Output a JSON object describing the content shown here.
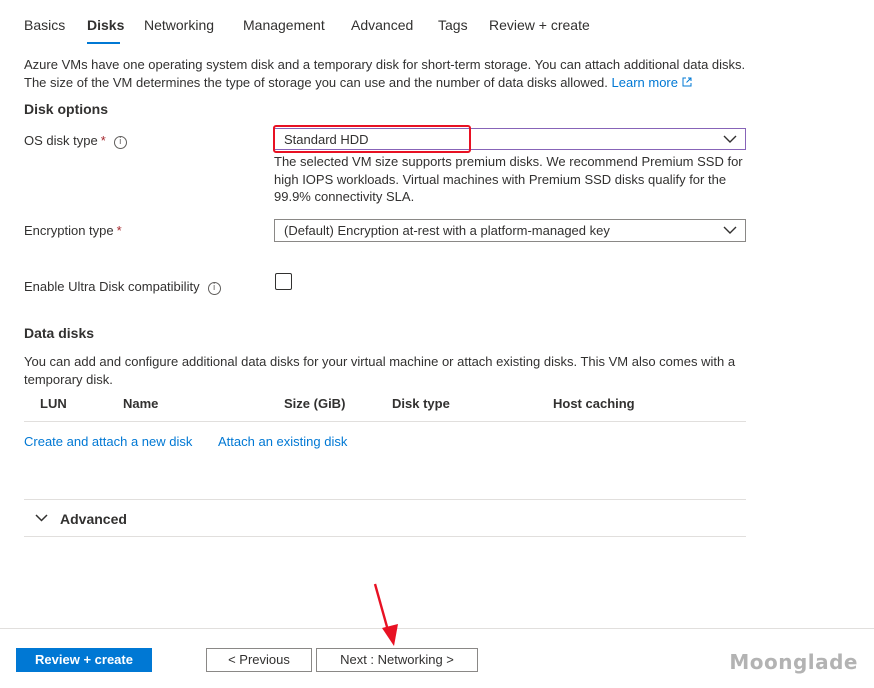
{
  "tabs": [
    {
      "label": "Basics",
      "active": false
    },
    {
      "label": "Disks",
      "active": true
    },
    {
      "label": "Networking",
      "active": false
    },
    {
      "label": "Management",
      "active": false
    },
    {
      "label": "Advanced",
      "active": false
    },
    {
      "label": "Tags",
      "active": false
    },
    {
      "label": "Review + create",
      "active": false
    }
  ],
  "intro": {
    "text": "Azure VMs have one operating system disk and a temporary disk for short-term storage. You can attach additional data disks. The size of the VM determines the type of storage you can use and the number of data disks allowed.",
    "learn_more": "Learn more"
  },
  "disk_options": {
    "title": "Disk options",
    "os_disk_type": {
      "label": "OS disk type",
      "required": "*",
      "value": "Standard HDD",
      "hint": "The selected VM size supports premium disks. We recommend Premium SSD for high IOPS workloads. Virtual machines with Premium SSD disks qualify for the 99.9% connectivity SLA."
    },
    "encryption_type": {
      "label": "Encryption type",
      "required": "*",
      "value": "(Default) Encryption at-rest with a platform-managed key"
    },
    "ultra_disk": {
      "label": "Enable Ultra Disk compatibility",
      "checked": false
    }
  },
  "data_disks": {
    "title": "Data disks",
    "description": "You can add and configure additional data disks for your virtual machine or attach existing disks. This VM also comes with a temporary disk.",
    "columns": [
      "LUN",
      "Name",
      "Size (GiB)",
      "Disk type",
      "Host caching"
    ],
    "create_link": "Create and attach a new disk",
    "attach_link": "Attach an existing disk"
  },
  "advanced_section": {
    "label": "Advanced"
  },
  "footer": {
    "review_create": "Review + create",
    "previous": "< Previous",
    "next": "Next : Networking >"
  },
  "watermark": "Moonglade",
  "colors": {
    "accent": "#0078d4",
    "annotation": "#e81123"
  }
}
